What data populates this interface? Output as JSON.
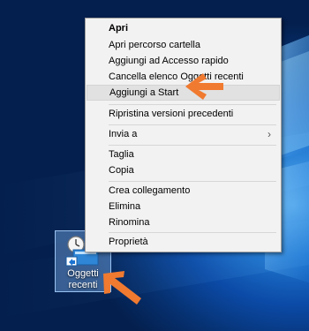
{
  "context_menu": {
    "items": [
      {
        "label": "Apri",
        "bold": true
      },
      {
        "label": "Apri percorso cartella"
      },
      {
        "label": "Aggiungi ad Accesso rapido"
      },
      {
        "label": "Cancella elenco Oggetti recenti"
      },
      {
        "label": "Aggiungi a Start",
        "highlighted": true
      },
      {
        "label": "Ripristina versioni precedenti"
      },
      {
        "label": "Invia a",
        "submenu": true
      },
      {
        "label": "Taglia"
      },
      {
        "label": "Copia"
      },
      {
        "label": "Crea collegamento"
      },
      {
        "label": "Elimina"
      },
      {
        "label": "Rinomina"
      },
      {
        "label": "Proprietà"
      }
    ],
    "submenu_glyph": "›"
  },
  "desktop_icon": {
    "label": "Oggetti recenti",
    "icon": "recent-items-icon",
    "selected": true
  },
  "annotations": {
    "arrow_color": "#f07a30",
    "pointer_icon": "orange-arrow-icon"
  },
  "colors": {
    "menu_background": "#f2f2f2",
    "menu_highlight": "#e1e1e1",
    "desktop_background": "#0b4aa6"
  }
}
